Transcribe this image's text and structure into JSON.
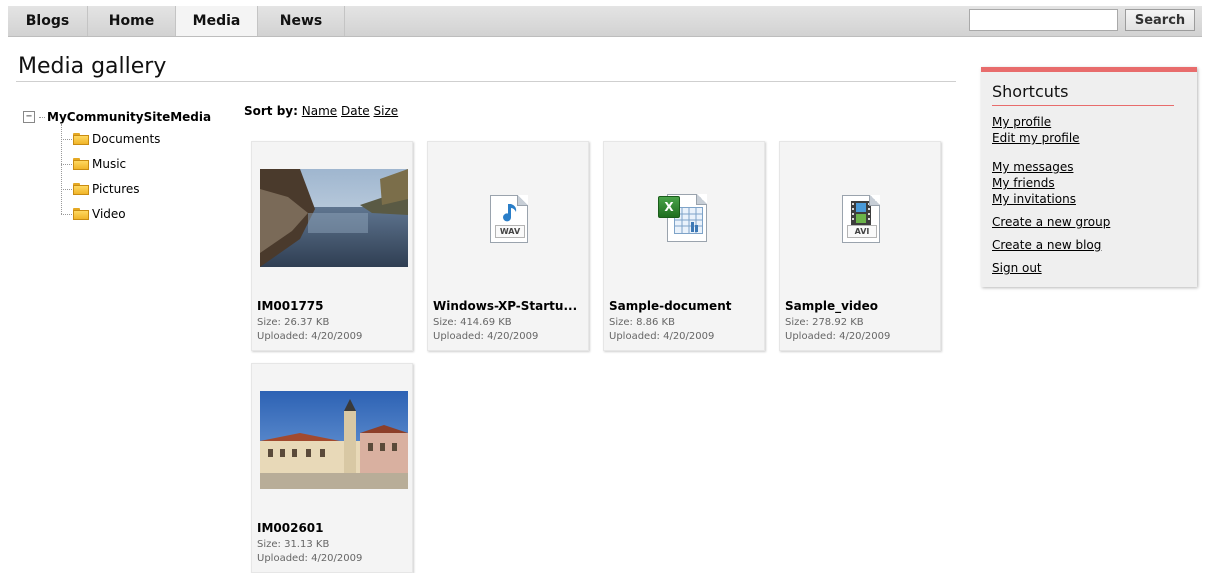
{
  "nav": {
    "tabs": [
      {
        "label": "Blogs"
      },
      {
        "label": "Home"
      },
      {
        "label": "Media",
        "active": true
      },
      {
        "label": "News"
      }
    ],
    "search": {
      "value": "",
      "placeholder": "",
      "button_label": "Search"
    }
  },
  "page": {
    "title": "Media gallery"
  },
  "tree": {
    "root": "MyCommunitySiteMedia",
    "toggle": "−",
    "items": [
      "Documents",
      "Music",
      "Pictures",
      "Video"
    ]
  },
  "sort": {
    "label": "Sort by:",
    "options": [
      "Name",
      "Date",
      "Size"
    ]
  },
  "gallery": [
    {
      "name": "IM001775",
      "size": "Size:  26.37 KB",
      "uploaded": "Uploaded: 4/20/2009",
      "kind": "image-river"
    },
    {
      "name": "Windows-XP-Startu...",
      "size": "Size:  414.69 KB",
      "uploaded": "Uploaded: 4/20/2009",
      "kind": "wav-icon",
      "tag": "WAV"
    },
    {
      "name": "Sample-document",
      "size": "Size:  8.86 KB",
      "uploaded": "Uploaded: 4/20/2009",
      "kind": "excel-icon"
    },
    {
      "name": "Sample_video",
      "size": "Size:  278.92 KB",
      "uploaded": "Uploaded: 4/20/2009",
      "kind": "avi-icon",
      "tag": "AVI"
    },
    {
      "name": "IM002601",
      "size": "Size:  31.13 KB",
      "uploaded": "Uploaded: 4/20/2009",
      "kind": "image-townhall"
    }
  ],
  "shortcuts": {
    "title": "Shortcuts",
    "links": [
      "My profile",
      "Edit my profile",
      "My messages",
      "My friends",
      "My invitations",
      "Create a new group",
      "Create a new blog",
      "Sign out"
    ]
  },
  "colors": {
    "accent": "#e86c6c",
    "card_bg": "#f4f4f4",
    "nav_bg": "#d8d8d8"
  }
}
